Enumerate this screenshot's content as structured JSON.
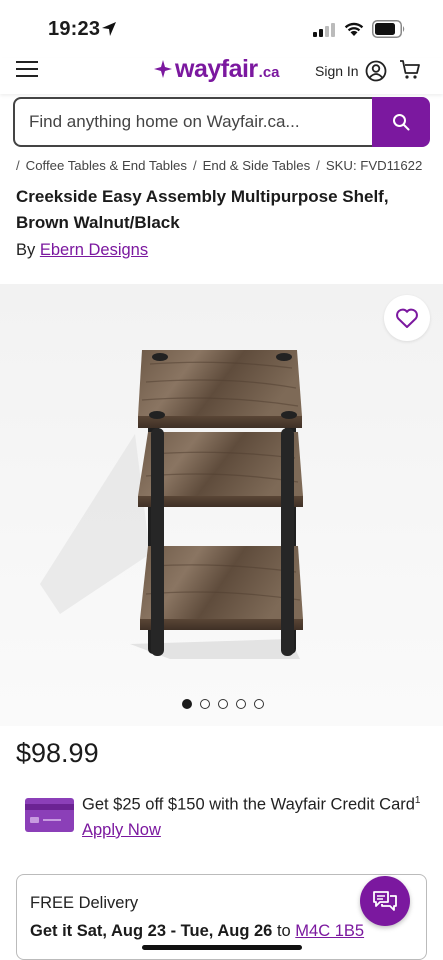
{
  "status_bar": {
    "time": "19:23",
    "icons": [
      "location-arrow-icon",
      "cellular-signal-icon",
      "wifi-icon",
      "battery-icon"
    ]
  },
  "header": {
    "logo_word": "wayfair",
    "logo_tld": ".ca",
    "sign_in_label": "Sign In",
    "icons": [
      "menu-icon",
      "user-icon",
      "cart-icon"
    ]
  },
  "search": {
    "placeholder": "Find anything home on Wayfair.ca...",
    "value": ""
  },
  "breadcrumb": {
    "separator": "/",
    "items": [
      "Coffee Tables & End Tables",
      "End & Side Tables"
    ],
    "sku": "SKU: FVD11622"
  },
  "product": {
    "title": "Creekside Easy Assembly Multipurpose Shelf, Brown Walnut/Black",
    "by_prefix": "By",
    "brand": "Ebern Designs",
    "price": "$98.99"
  },
  "gallery": {
    "image_count": 5,
    "active_index": 0
  },
  "promo": {
    "text": "Get $25 off $150 with the Wayfair Credit Card",
    "superscript": "1",
    "link_label": "Apply Now"
  },
  "delivery": {
    "title": "FREE Delivery",
    "get_it_label": "Get it Sat, Aug 23 - Tue, Aug 26",
    "to_label": "to",
    "postal_code": "M4C 1B5"
  },
  "colors": {
    "brand_purple": "#7b189f",
    "text": "#1b1b1b",
    "card_purple": "#8b3fb8"
  }
}
